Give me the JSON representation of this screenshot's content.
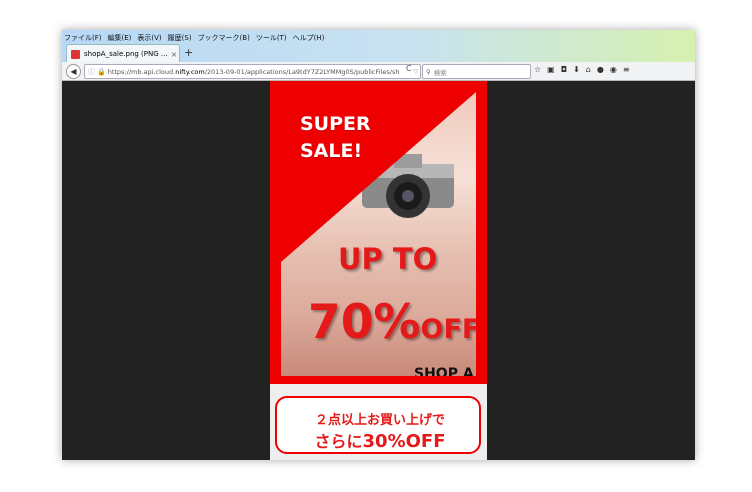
{
  "browser": {
    "menu": [
      "ファイル(F)",
      "編集(E)",
      "表示(V)",
      "履歴(S)",
      "ブックマーク(B)",
      "ツール(T)",
      "ヘルプ(H)"
    ],
    "tab_title": "shopA_sale.png (PNG ...",
    "new_tab": "+",
    "url_host_prefix": "https://mb.api.cloud.",
    "url_host_bold": "nifty.com",
    "url_path": "/2013-09-01/applications/La9tdY7Z2LYMMg0S/publicFiles/sh",
    "search_placeholder": "検索"
  },
  "ad": {
    "super_line1": "SUPER",
    "super_line2": "SALE!",
    "up_to": "UP TO",
    "percent": "70%",
    "off": "OFF",
    "shop": "SHOP A",
    "banner_line1": "２点以上お買い上げで",
    "banner_line2_prefix": "さらに",
    "banner_line2_big": "30%OFF"
  },
  "colors": {
    "accent": "#ee0000",
    "text_red": "#e41a1a"
  }
}
